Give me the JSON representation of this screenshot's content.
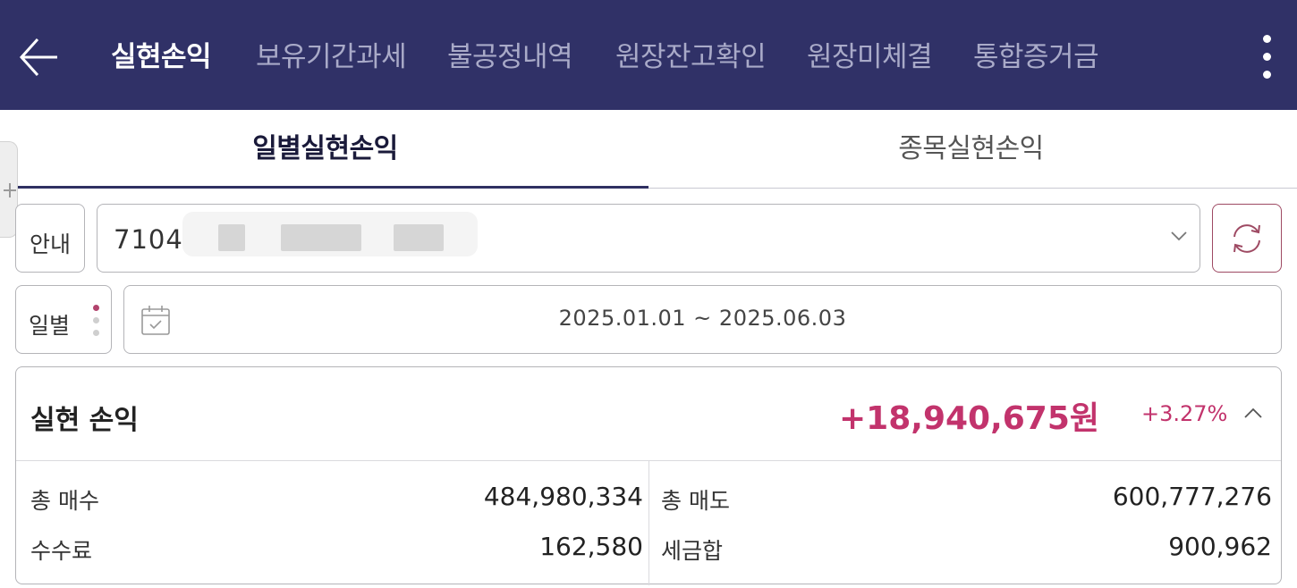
{
  "header": {
    "tabs": [
      {
        "label": "실현손익",
        "active": true
      },
      {
        "label": "보유기간과세",
        "active": false
      },
      {
        "label": "불공정내역",
        "active": false
      },
      {
        "label": "원장잔고확인",
        "active": false
      },
      {
        "label": "원장미체결",
        "active": false
      },
      {
        "label": "통합증거금",
        "active": false
      }
    ],
    "back_icon": "arrow-left-icon",
    "more_icon": "kebab-menu-icon"
  },
  "sub_tabs": [
    {
      "label": "일별실현손익",
      "active": true
    },
    {
      "label": "종목실현손익",
      "active": false
    }
  ],
  "account": {
    "guide_label": "안내",
    "number_prefix": "7104-",
    "dropdown_icon": "chevron-down-icon",
    "refresh_icon": "refresh-icon"
  },
  "period": {
    "mode_label": "일별",
    "calendar_icon": "calendar-icon",
    "range": "2025.01.01 ~ 2025.06.03"
  },
  "summary": {
    "title": "실현 손익",
    "amount": "+18,940,675원",
    "percent": "+3.27%",
    "collapse_icon": "chevron-up-icon",
    "rows": {
      "total_buy_label": "총 매수",
      "total_buy_value": "484,980,334",
      "total_sell_label": "총 매도",
      "total_sell_value": "600,777,276",
      "fee_label": "수수료",
      "fee_value": "162,580",
      "tax_label": "세금합",
      "tax_value": "900,962"
    }
  },
  "colors": {
    "header_bg": "#303167",
    "accent": "#c2336c",
    "refresh_border": "#9e4a63"
  }
}
